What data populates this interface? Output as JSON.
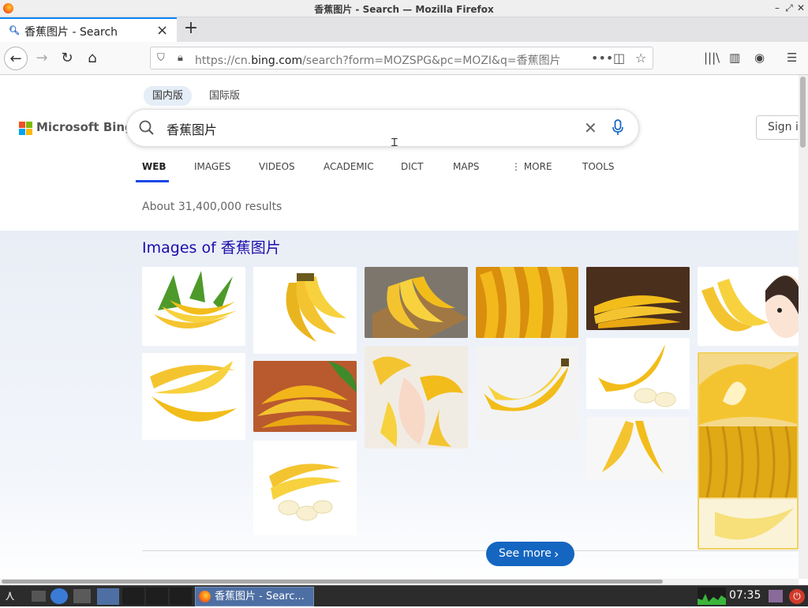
{
  "window": {
    "title": "香蕉图片 - Search — Mozilla Firefox"
  },
  "tabs": [
    {
      "label": "香蕉图片 - Search"
    }
  ],
  "navbar": {
    "url_prefix": "https://cn.",
    "url_domain": "bing.com",
    "url_rest": "/search?form=MOZSPG&pc=MOZI&q=香蕉图片"
  },
  "bing": {
    "scopes": [
      "国内版",
      "国际版"
    ],
    "logo_text": "Microsoft Bing",
    "query": "香蕉图片",
    "signin_label": "Sign in",
    "tabs": [
      "WEB",
      "IMAGES",
      "VIDEOS",
      "ACADEMIC",
      "DICT",
      "MAPS",
      "MORE",
      "TOOLS"
    ],
    "results_count": "About 31,400,000 results",
    "images_heading": "Images of 香蕉图片",
    "see_more": "See more"
  },
  "taskbar": {
    "task_label": "香蕉图片 - Searc...",
    "clock": "07:35"
  },
  "colors": {
    "accent": "#174ae4",
    "link": "#1a0dab",
    "button": "#1466c0",
    "banana": "#f2c21b"
  }
}
